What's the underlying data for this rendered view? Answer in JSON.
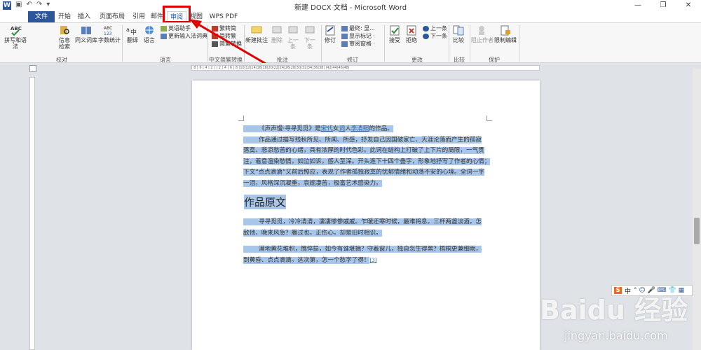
{
  "window": {
    "title": "新建 DOCX 文档 - Microsoft Word",
    "icon_label": "W"
  },
  "qat": {
    "save": "▣",
    "undo": "↶",
    "redo": "↷",
    "more": "▾"
  },
  "win_controls": {
    "minimize": "—",
    "restore": "❐",
    "close": "✕"
  },
  "tabs": [
    "文件",
    "开始",
    "插入",
    "页面布局",
    "引用",
    "邮件",
    "审阅",
    "视图",
    "WPS PDF"
  ],
  "active_tab": "审阅",
  "ribbon": {
    "proofing": {
      "spell": "拼写和语法",
      "info_1": "信息",
      "info_2": "检索",
      "thesaurus": "同义词库",
      "wordcount": "字数统计",
      "group": "校对"
    },
    "language": {
      "translate": "翻译",
      "language": "语言",
      "eng_assist": "英语助手",
      "ime_update": "更新输入法词典",
      "group": "语言"
    },
    "chinese": {
      "t2s": "繁转简",
      "s2t": "简转繁",
      "convert": "简繁转换",
      "group": "中文简繁转换"
    },
    "comments": {
      "new": "新建批注",
      "delete": "删除",
      "prev": "上一条",
      "next": "下一条",
      "group": "批注"
    },
    "tracking": {
      "track": "修订",
      "final": "最终: 显...",
      "show_markup": "显示标记 ·",
      "pane": "审阅窗格 ·",
      "group": "修订"
    },
    "changes": {
      "accept": "接受",
      "reject": "拒绝",
      "prev": "上一条",
      "next": "下一条",
      "group": "更改"
    },
    "compare": {
      "compare": "比较",
      "group": "比较"
    },
    "protect": {
      "block": "阻止作者",
      "restrict": "限制编辑",
      "group": "保护"
    }
  },
  "ruler": {
    "marks": "| 8 | 6 | 4 | 2 |  | 2 | 4 | 6 | 8 |10|12|14|16|18|20|22|24|26|28|30|32|34|36|38|  |42|44|46|48|"
  },
  "document": {
    "p1_line1_pre": "《声声慢·寻寻觅觅》是",
    "p1_link1": "宋代",
    "p1_mid1": "女",
    "p1_link2": "词",
    "p1_mid2": "人",
    "p1_link3": "李清照",
    "p1_line1_post": "的作品。",
    "p1_lines": [
      "作品通过描写残秋所见、所闻、所感，抒发自己因国破家亡、天涯沦落而产生的孤寂",
      "落寞、悲凉愁苦的心绪，具有浓厚的时代色彩。此词在结构上打破了上下片的局限，一气贯",
      "注，着意渲染愁情，如泣如诉，感人至深。开头连下十四个叠字，形象地抒写了作者的心情；",
      "下文“点点滴滴”又前后照应，表现了作者孤独寂寞的忧郁情绪和动荡不安的心境。全词一字",
      "一泪，风格深沉凝重，哀婉凄苦，极富艺术感染力。"
    ],
    "heading": "作品原文",
    "p2_lines": [
      "寻寻觅觅，冷冷清清，凄凄惨惨戚戚。乍暖还寒时候，最难将息。三杯两盏淡酒，怎",
      "敌他、晚来风急？雁过也，正伤心，却是旧时相识。"
    ],
    "p3_lines": [
      "满地黄花堆积，憔悴损，如今有谁堪摘？守着窗儿，独自怎生得黑？梧桐更兼细雨，",
      "到黄昏、点点滴滴。这次第，怎一个愁字了得！"
    ],
    "p3_ref": "[3]"
  },
  "ime_bar": {
    "s": "S",
    "lang": "中",
    "items": "° ☺ 🎤 ⌨ 👕 ▦"
  },
  "watermark": {
    "brand": "Baidu 经验",
    "url": "jingyan.baidu.com"
  },
  "colors": {
    "accent": "#2b579a",
    "selection": "#a7c6ea",
    "highlight": "#e00000"
  }
}
